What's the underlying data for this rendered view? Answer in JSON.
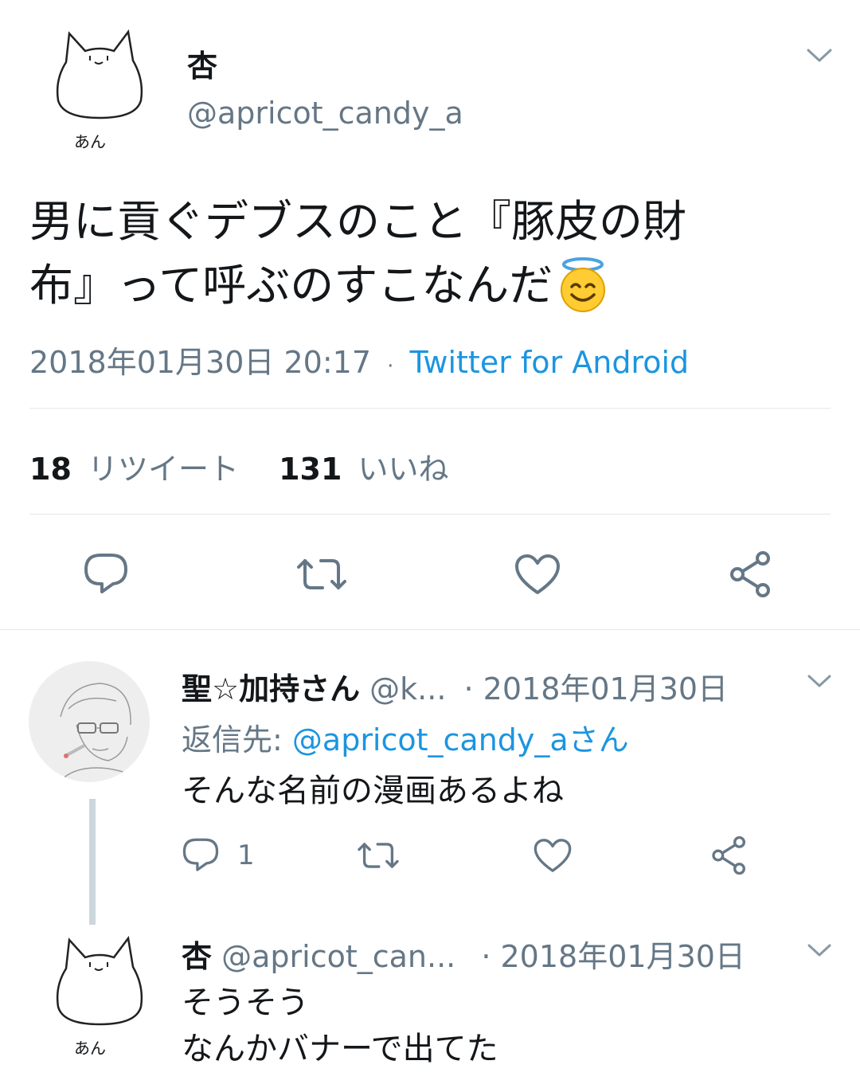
{
  "main_tweet": {
    "display_name": "杏",
    "handle": "@apricot_candy_a",
    "avatar_caption": "あん",
    "text_line1": "男に貢ぐデブスのこと『豚皮の財",
    "text_line2": "布』って呼ぶのすこなんだ",
    "timestamp": "2018年01月30日 20:17",
    "separator": "·",
    "source": "Twitter for Android",
    "retweet_count": "18",
    "retweet_label": "リツイート",
    "like_count": "131",
    "like_label": "いいね"
  },
  "reply1": {
    "display_name": "聖☆加持さん",
    "handle": "@k...",
    "date": "· 2018年01月30日",
    "reply_to_label": "返信先:",
    "reply_to_handle": "@apricot_candy_aさん",
    "text": "そんな名前の漫画あるよね",
    "reply_count": "1"
  },
  "reply2": {
    "display_name": "杏",
    "handle": "@apricot_can...",
    "date": "· 2018年01月30日",
    "avatar_caption": "あん",
    "text_line1": "そうそう",
    "text_line2": "なんかバナーで出てた"
  },
  "icons": {
    "reply": "reply-icon",
    "retweet": "retweet-icon",
    "like": "heart-icon",
    "share": "share-icon",
    "menu": "chevron-down-icon",
    "emoji": "smiling-face-with-halo-emoji"
  },
  "colors": {
    "text": "#14171a",
    "muted": "#657786",
    "link": "#1b95e0",
    "divider": "#e1e8ed",
    "thread_line": "#ccd6dd"
  }
}
